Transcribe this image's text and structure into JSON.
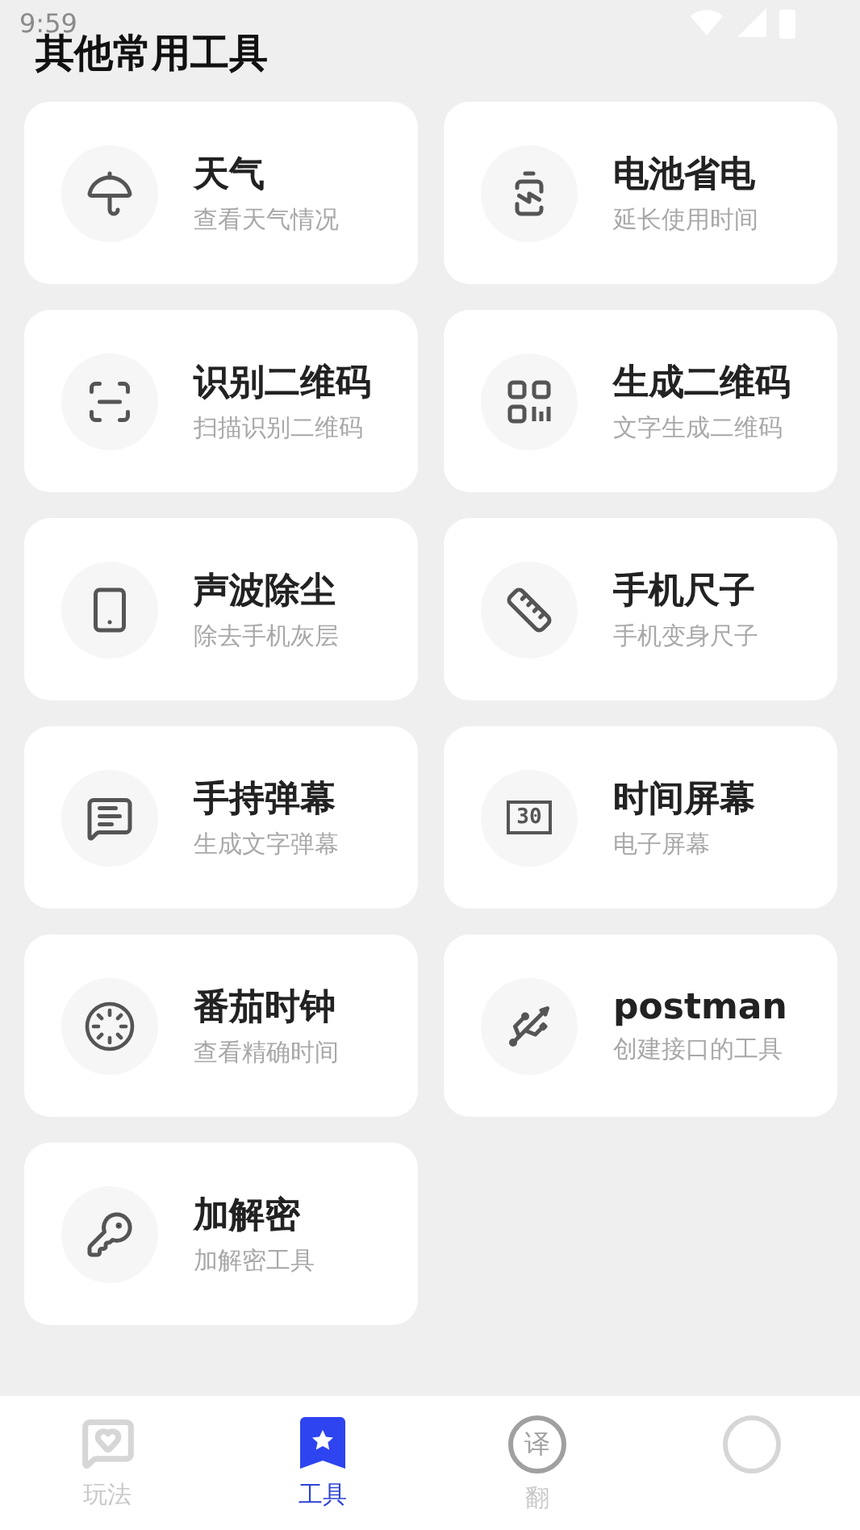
{
  "status_bar": {
    "time": "9:59"
  },
  "title": "其他常用工具",
  "tools": [
    {
      "name": "天气",
      "desc": "查看天气情况"
    },
    {
      "name": "电池省电",
      "desc": "延长使用时间"
    },
    {
      "name": "识别二维码",
      "desc": "扫描识别二维码"
    },
    {
      "name": "生成二维码",
      "desc": "文字生成二维码"
    },
    {
      "name": "声波除尘",
      "desc": "除去手机灰层"
    },
    {
      "name": "手机尺子",
      "desc": "手机变身尺子"
    },
    {
      "name": "手持弹幕",
      "desc": "生成文字弹幕"
    },
    {
      "name": "时间屏幕",
      "desc": "电子屏幕",
      "icon_text": "30"
    },
    {
      "name": "番茄时钟",
      "desc": "查看精确时间"
    },
    {
      "name": "postman",
      "desc": "创建接口的工具"
    },
    {
      "name": "加解密",
      "desc": "加解密工具"
    }
  ],
  "tabs": [
    {
      "label": "玩法",
      "selected": false
    },
    {
      "label": "工具",
      "selected": true
    },
    {
      "label": "翻",
      "selected": false,
      "icon_text": "译"
    },
    {
      "selected": false
    }
  ]
}
